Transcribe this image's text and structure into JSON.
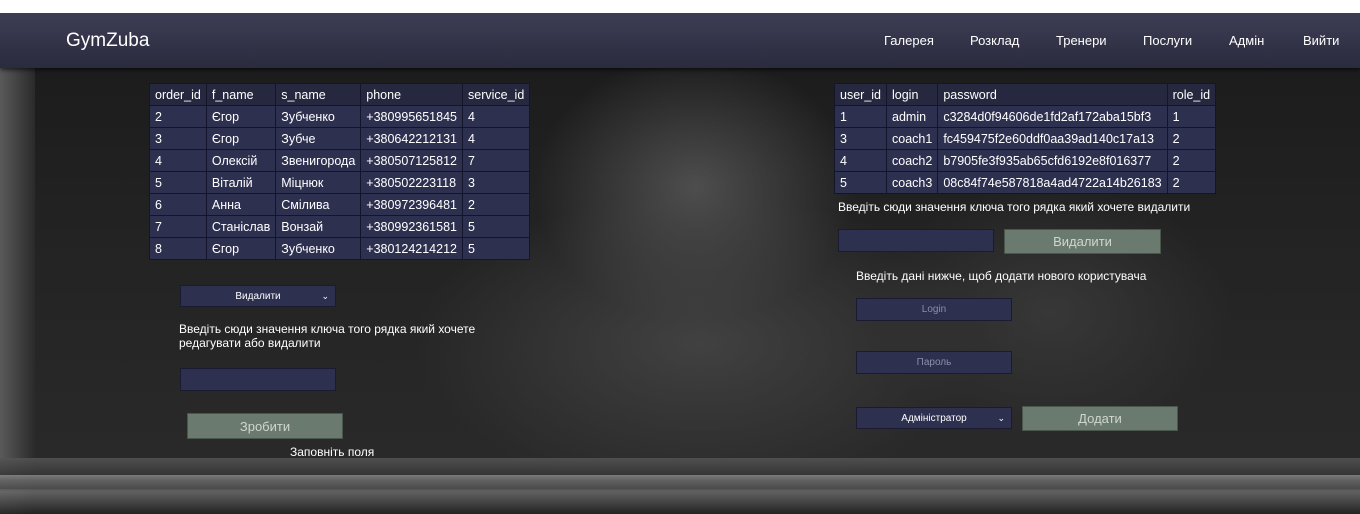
{
  "nav": {
    "brand": "GymZuba",
    "links": [
      "Галерея",
      "Розклад",
      "Тренери",
      "Послуги",
      "Адмін",
      "Вийти"
    ]
  },
  "orders": {
    "headers": [
      "order_id",
      "f_name",
      "s_name",
      "phone",
      "service_id"
    ],
    "rows": [
      [
        "2",
        "Єгор",
        "Зубченко",
        "+380995651845",
        "4"
      ],
      [
        "3",
        "Єгор",
        "Зубче",
        "+380642212131",
        "4"
      ],
      [
        "4",
        "Олексій",
        "Звенигорода",
        "+380507125812",
        "7"
      ],
      [
        "5",
        "Віталій",
        "Міцнюк",
        "+380502223118",
        "3"
      ],
      [
        "6",
        "Анна",
        "Смілива",
        "+380972396481",
        "2"
      ],
      [
        "7",
        "Станіслав",
        "Вонзай",
        "+380992361581",
        "5"
      ],
      [
        "8",
        "Єгор",
        "Зубченко",
        "+380124214212",
        "5"
      ]
    ]
  },
  "users": {
    "headers": [
      "user_id",
      "login",
      "password",
      "role_id"
    ],
    "rows": [
      [
        "1",
        "admin",
        "c3284d0f94606de1fd2af172aba15bf3",
        "1"
      ],
      [
        "3",
        "coach1",
        "fc459475f2e60ddf0aa39ad140c17a13",
        "2"
      ],
      [
        "4",
        "coach2",
        "b7905fe3f935ab65cfd6192e8f016377",
        "2"
      ],
      [
        "5",
        "coach3",
        "08c84f74e587818a4ad4722a14b26183",
        "2"
      ]
    ]
  },
  "left_form": {
    "action_select": "Видалити",
    "instruction": "Введіть сюди значення ключа того рядка який хочете редагувати або видалити",
    "key_value": "",
    "submit_label": "Зробити",
    "hint": "Заповніть поля"
  },
  "right_form": {
    "delete_instruction": "Введіть сюди значення ключа того рядка який хочете видалити",
    "delete_key_value": "",
    "delete_label": "Видалити",
    "add_instruction": "Введіть дані нижче, щоб додати нового користувача",
    "login_placeholder": "Login",
    "password_placeholder": "Пароль",
    "role_select": "Адміністратор",
    "add_label": "Додати"
  },
  "colors": {
    "navbar": "#2b2b3e",
    "table_cell": "#2e3050",
    "button": "#6b7a6e"
  }
}
